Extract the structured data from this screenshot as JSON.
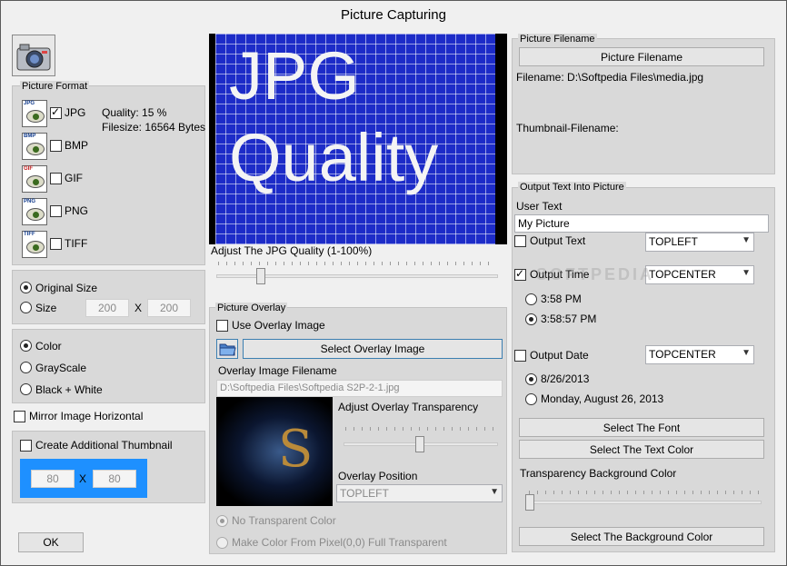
{
  "window": {
    "title": "Picture Capturing"
  },
  "picture_format": {
    "title": "Picture Format",
    "formats": [
      {
        "icon": "JPG",
        "label": "JPG",
        "checked": true
      },
      {
        "icon": "BMP",
        "label": "BMP",
        "checked": false
      },
      {
        "icon": "GIF",
        "label": "GIF",
        "checked": false
      },
      {
        "icon": "PNG",
        "label": "PNG",
        "checked": false
      },
      {
        "icon": "TIFF",
        "label": "TIFF",
        "checked": false
      }
    ],
    "quality": "Quality: 15 %",
    "filesize": "Filesize: 16564 Bytes"
  },
  "size": {
    "original_label": "Original Size",
    "size_label": "Size",
    "width": "200",
    "height": "200",
    "x_sep": "X"
  },
  "color_mode": {
    "color": "Color",
    "grayscale": "GrayScale",
    "bw": "Black + White"
  },
  "mirror": {
    "label": "Mirror Image Horizontal"
  },
  "thumbnail": {
    "label": "Create Additional Thumbnail",
    "width": "80",
    "height": "80",
    "x_sep": "X"
  },
  "ok_button": "OK",
  "preview": {
    "line1": "JPG",
    "line2": "Quality",
    "slider_label": "Adjust The JPG Quality (1-100%)",
    "slider_value_percent": 15
  },
  "overlay": {
    "title": "Picture Overlay",
    "use_label": "Use Overlay Image",
    "select_button": "Select Overlay Image",
    "filename_label": "Overlay Image Filename",
    "filename_value": "D:\\Softpedia Files\\Softpedia S2P-2-1.jpg",
    "transparency_label": "Adjust Overlay Transparency",
    "transparency_percent": 48,
    "position_label": "Overlay Position",
    "position_value": "TOPLEFT",
    "no_transparent": "No Transparent Color",
    "make_color": "Make Color From Pixel(0,0) Full Transparent"
  },
  "picture_filename": {
    "title": "Picture Filename",
    "button": "Picture Filename",
    "filename": "Filename: D:\\Softpedia Files\\media.jpg",
    "thumbnail_filename": "Thumbnail-Filename:"
  },
  "output_text": {
    "title": "Output Text Into Picture",
    "user_text_label": "User Text",
    "user_text_value": "My Picture",
    "output_text_label": "Output Text",
    "output_text_pos": "TOPLEFT",
    "output_time_label": "Output Time",
    "output_time_pos": "TOPCENTER",
    "time_short": "3:58 PM",
    "time_long": "3:58:57 PM",
    "output_date_label": "Output Date",
    "output_date_pos": "TOPCENTER",
    "date_short": "8/26/2013",
    "date_long": "Monday, August 26, 2013",
    "font_button": "Select The Font",
    "text_color_button": "Select The Text Color",
    "transparency_bg_label": "Transparency Background Color",
    "transparency_bg_percent": 0,
    "bg_color_button": "Select The Background Color"
  },
  "watermark": "SOFTPEDIA"
}
